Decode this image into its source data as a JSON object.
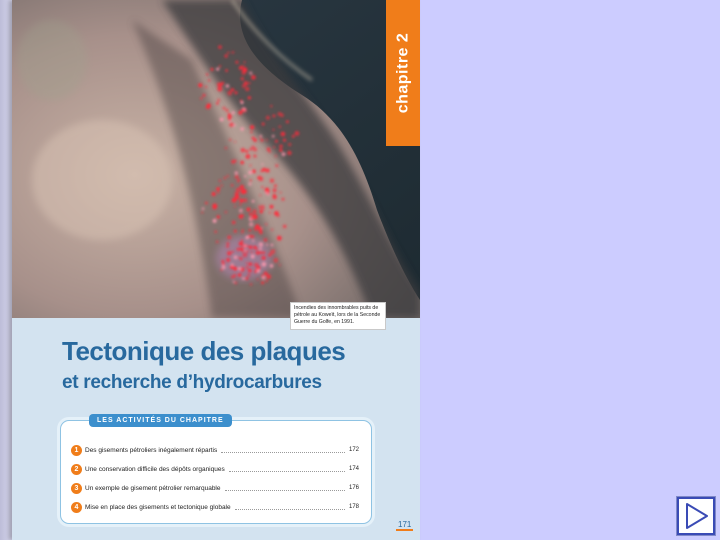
{
  "chapter_tab": {
    "text": "chapitre 2"
  },
  "caption": {
    "text": "Incendies des innombrables puits de pétrole au Koweït, lors de la Seconde Guerre du Golfe, en 1991."
  },
  "title": {
    "main": "Tectonique des plaques",
    "sub": "et recherche d’hydrocarbures"
  },
  "activities": {
    "header": "LES ACTIVITÉS DU CHAPITRE",
    "items": [
      {
        "num": "1",
        "label": "Des gisements pétroliers inégalement répartis",
        "page": "172"
      },
      {
        "num": "2",
        "label": "Une conservation difficile des dépôts organiques",
        "page": "174"
      },
      {
        "num": "3",
        "label": "Un exemple de gisement pétrolier remarquable",
        "page": "176"
      },
      {
        "num": "4",
        "label": "Mise en place des gisements et tectonique globale",
        "page": "178"
      }
    ]
  },
  "folio": "171",
  "nav": {
    "next_icon": "play-triangle-icon"
  },
  "colors": {
    "slide_background": "#ccccff",
    "chapter_orange": "#f07d1a",
    "title_blue": "#28699e",
    "header_blue": "#3c8fcd"
  }
}
